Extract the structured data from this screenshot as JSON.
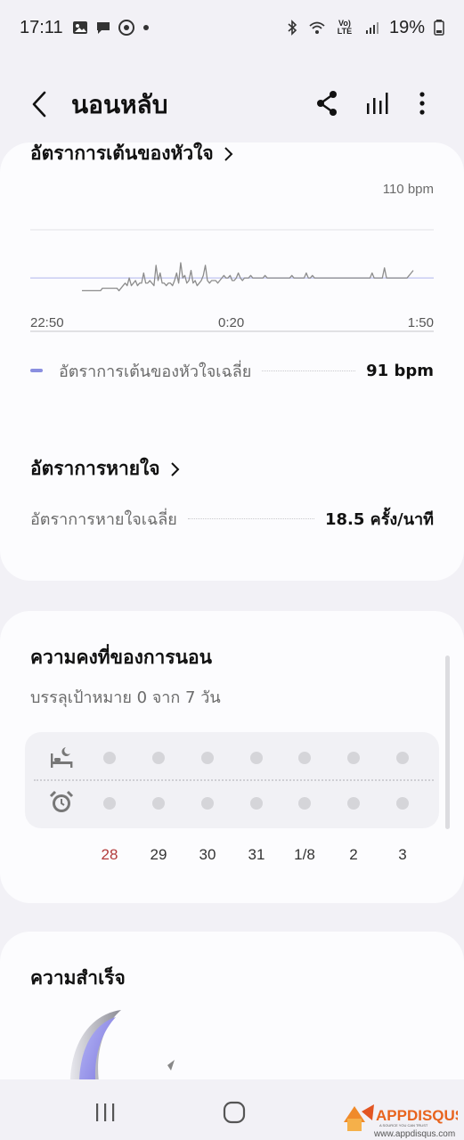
{
  "status_bar": {
    "time": "17:11",
    "network_label": "Vo) LTE",
    "battery": "19%"
  },
  "app_bar": {
    "title": "นอนหลับ",
    "icons": [
      "back-icon",
      "share-icon",
      "bar-chart-icon",
      "more-vert-icon"
    ]
  },
  "heart_rate": {
    "title": "อัตราการเต้นของหัวใจ",
    "y_max_label": "110 bpm",
    "x_ticks": [
      "22:50",
      "0:20",
      "1:50"
    ],
    "legend_label": "อัตราการเต้นของหัวใจเฉลี่ย",
    "legend_value": "91 bpm"
  },
  "chart_data": {
    "type": "line",
    "series": [
      {
        "values": [
          86,
          86,
          86,
          86,
          86,
          86,
          86,
          86,
          86,
          86,
          87,
          87,
          87,
          87,
          87,
          87,
          87,
          87,
          86,
          87,
          88,
          89,
          88,
          91,
          88,
          89,
          90,
          88,
          89,
          89,
          93,
          89,
          89,
          90,
          89,
          88,
          96,
          90,
          93,
          89,
          89,
          88,
          89,
          89,
          88,
          90,
          93,
          89,
          97,
          91,
          92,
          89,
          90,
          94,
          89,
          90,
          88,
          89,
          90,
          92,
          96,
          90,
          89,
          90,
          90,
          90,
          89,
          90,
          91,
          92,
          91,
          91,
          92,
          90,
          90,
          91,
          93,
          91,
          90,
          91,
          91,
          91,
          92,
          91,
          91,
          91,
          91,
          91,
          91,
          92,
          91,
          91,
          91,
          91,
          91,
          91,
          91,
          91,
          91,
          91,
          91,
          91,
          92,
          91,
          91,
          91,
          91,
          91,
          91,
          93,
          91,
          91,
          92,
          91,
          91,
          91,
          91,
          91,
          91,
          91,
          91,
          91,
          91,
          91,
          91,
          91,
          91,
          91,
          91,
          91,
          91,
          91,
          91,
          91,
          91,
          91,
          91,
          91,
          91,
          91,
          91,
          93,
          91,
          91,
          91,
          91,
          91,
          95,
          91,
          91,
          91,
          91,
          91,
          91,
          91,
          91,
          91,
          91,
          91,
          92,
          93,
          94
        ]
      }
    ],
    "x_range": [
      "22:50",
      "1:50"
    ],
    "ylim": [
      70,
      110
    ],
    "reference_line": 91
  },
  "respiration": {
    "title": "อัตราการหายใจ",
    "avg_label": "อัตราการหายใจเฉลี่ย",
    "avg_value": "18.5 ครั้ง/นาที"
  },
  "consistency": {
    "title": "ความคงที่ของการนอน",
    "subtitle": "บรรลุเป้าหมาย 0 จาก 7 วัน",
    "rows": [
      "bed-icon",
      "alarm-clock-icon"
    ],
    "days": [
      "28",
      "29",
      "30",
      "31",
      "1/8",
      "2",
      "3"
    ],
    "highlight_day_index": 0,
    "highlight_color": "#b23a3a"
  },
  "achievements": {
    "title": "ความสำเร็จ"
  },
  "nav_bar": {
    "icons": [
      "recent-apps-icon",
      "home-icon"
    ]
  },
  "watermark": {
    "logo_text": "APPDISQUS",
    "tagline": "A SOURCE YOU CAN TRUST",
    "url": "www.appdisqus.com"
  },
  "colors": {
    "background": "#f2f1f6",
    "card": "#fcfcfe",
    "chart_line": "#8c8c8c",
    "avg_line": "#c9cdf2",
    "accent": "#8a8fe0"
  }
}
